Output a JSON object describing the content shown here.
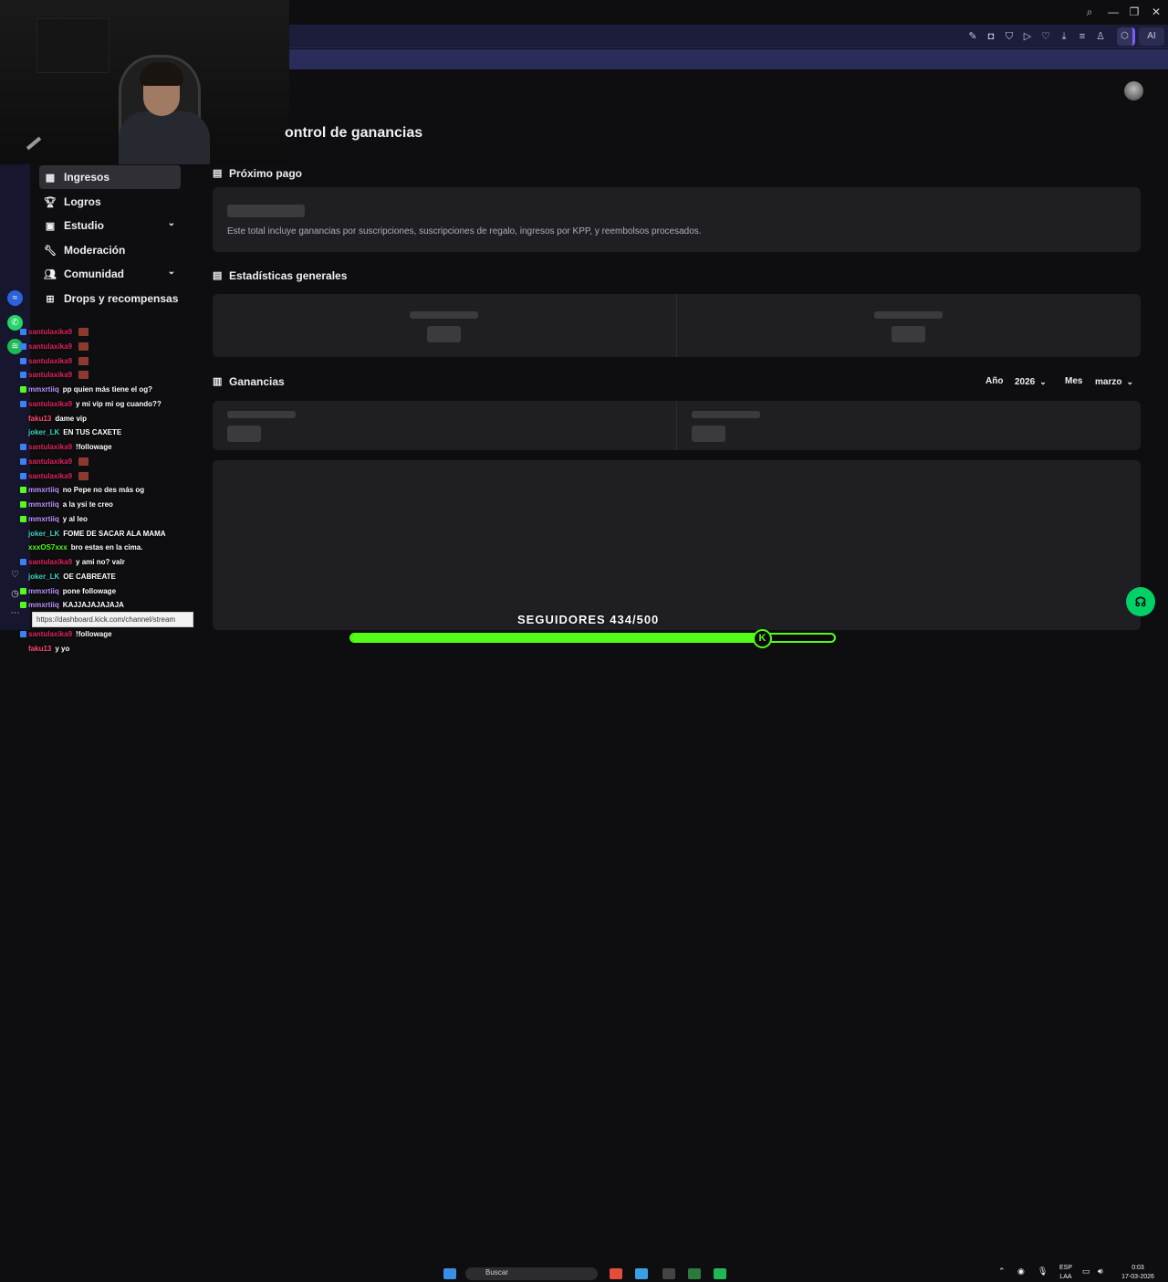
{
  "window": {
    "search_icon": "search-icon",
    "minimize": "—",
    "restore": "❐",
    "close": "✕"
  },
  "toolbar": {
    "ai_label": "AI"
  },
  "page": {
    "title": "ontrol de ganancias"
  },
  "nav": {
    "items": [
      {
        "label": "Ingresos",
        "icon": "chart-icon",
        "active": true,
        "expandable": false
      },
      {
        "label": "Logros",
        "icon": "trophy-icon",
        "active": false,
        "expandable": false
      },
      {
        "label": "Estudio",
        "icon": "studio-icon",
        "active": false,
        "expandable": true
      },
      {
        "label": "Moderación",
        "icon": "wrench-icon",
        "active": false,
        "expandable": false
      },
      {
        "label": "Comunidad",
        "icon": "community-icon",
        "active": false,
        "expandable": true
      },
      {
        "label": "Drops y recompensas",
        "icon": "gift-icon",
        "active": false,
        "expandable": false
      }
    ]
  },
  "sections": {
    "next_payment": {
      "title": "Próximo pago",
      "description": "Este total incluye ganancias por suscripciones, suscripciones de regalo, ingresos por KPP, y reembolsos procesados."
    },
    "general_stats": {
      "title": "Estadísticas generales"
    },
    "earnings": {
      "title": "Ganancias",
      "year_label": "Año",
      "year_value": "2026",
      "month_label": "Mes",
      "month_value": "marzo"
    }
  },
  "chat": {
    "messages": [
      {
        "user": "santulaxika9",
        "text": "",
        "emote": true,
        "color": "#e0245e"
      },
      {
        "user": "santulaxika9",
        "text": "",
        "emote": true,
        "color": "#e0245e"
      },
      {
        "user": "santulaxika9",
        "text": "",
        "emote": true,
        "color": "#e0245e"
      },
      {
        "user": "santulaxika9",
        "text": "",
        "emote": true,
        "color": "#e0245e"
      },
      {
        "user": "mmxrtiiq",
        "text": "pp quien más tiene el og?",
        "emote": false,
        "color": "#b894ff"
      },
      {
        "user": "santulaxika9",
        "text": "y mi vip mi og cuando??",
        "emote": false,
        "color": "#e0245e"
      },
      {
        "user": "faku13",
        "text": "dame vip",
        "emote": false,
        "color": "#ff4d6d"
      },
      {
        "user": "joker_LK",
        "text": "EN TUS CAXETE",
        "emote": false,
        "color": "#3cd3c5"
      },
      {
        "user": "santulaxika9",
        "text": "!followage",
        "emote": false,
        "color": "#e0245e"
      },
      {
        "user": "santulaxika9",
        "text": "",
        "emote": true,
        "color": "#e0245e"
      },
      {
        "user": "santulaxika9",
        "text": "",
        "emote": true,
        "color": "#e0245e"
      },
      {
        "user": "mmxrtiiq",
        "text": "no Pepe no des más og",
        "emote": false,
        "color": "#b894ff"
      },
      {
        "user": "mmxrtiiq",
        "text": "a la ysi te creo",
        "emote": false,
        "color": "#b894ff"
      },
      {
        "user": "mmxrtiiq",
        "text": "y al leo",
        "emote": false,
        "color": "#b894ff"
      },
      {
        "user": "joker_LK",
        "text": "FOME DE SACAR ALA MAMA",
        "emote": false,
        "color": "#3cd3c5"
      },
      {
        "user": "xxxOS7xxx",
        "text": "bro estas en la cima.",
        "emote": false,
        "color": "#53fc18"
      },
      {
        "user": "santulaxika9",
        "text": "y ami no? valr",
        "emote": false,
        "color": "#e0245e"
      },
      {
        "user": "joker_LK",
        "text": "OE CABREATE",
        "emote": false,
        "color": "#3cd3c5"
      },
      {
        "user": "mmxrtiiq",
        "text": "pone followage",
        "emote": false,
        "color": "#b894ff"
      },
      {
        "user": "mmxrtiiq",
        "text": "KAJJAJAJAJAJA",
        "emote": false,
        "color": "#b894ff"
      },
      {
        "user": "",
        "text": "",
        "emote": false,
        "color": "#53fc18"
      },
      {
        "user": "santulaxika9",
        "text": "!followage",
        "emote": false,
        "color": "#e0245e"
      },
      {
        "user": "faku13",
        "text": "y yo",
        "emote": false,
        "color": "#ff4d6d"
      }
    ]
  },
  "url_tooltip": "https://dashboard.kick.com/channel/stream",
  "goal": {
    "text": "SEGUIDORES 434/500",
    "current": 434,
    "target": 500
  },
  "taskbar": {
    "search_placeholder": "Buscar",
    "lang": "ESP",
    "lang_sub": "LAA",
    "time": "0:03",
    "date": "17-03-2026"
  }
}
